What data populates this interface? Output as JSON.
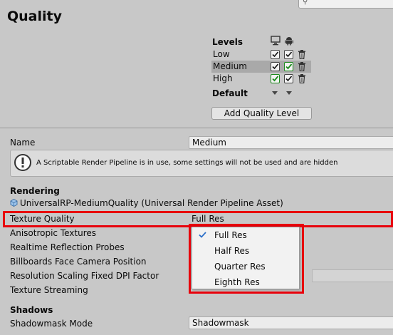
{
  "window": {
    "title": "Quality",
    "search_icon": "search-icon"
  },
  "levels": {
    "header": "Levels",
    "platforms": [
      "monitor-icon",
      "android-icon"
    ],
    "rows": [
      {
        "name": "Low",
        "selected": false,
        "pc": "checked",
        "android": "checked"
      },
      {
        "name": "Medium",
        "selected": true,
        "pc": "checked",
        "android": "checked-green"
      },
      {
        "name": "High",
        "selected": false,
        "pc": "checked-green",
        "android": "checked"
      }
    ],
    "default_label": "Default",
    "add_button": "Add Quality Level"
  },
  "settings": {
    "name_label": "Name",
    "name_value": "Medium",
    "help_text": "A Scriptable Render Pipeline is in use, some settings will not be used and are hidden",
    "rendering_header": "Rendering",
    "pipeline_asset": "UniversalRP-MediumQuality (Universal Render Pipeline Asset)",
    "texture_quality_label": "Texture Quality",
    "texture_quality_value": "Full Res",
    "anisotropic_label": "Anisotropic Textures",
    "realtime_reflection_label": "Realtime Reflection Probes",
    "billboards_label": "Billboards Face Camera Position",
    "resolution_scaling_label": "Resolution Scaling Fixed DPI Factor",
    "texture_streaming_label": "Texture Streaming",
    "shadows_header": "Shadows",
    "shadowmask_label": "Shadowmask Mode",
    "shadowmask_value": "Shadowmask"
  },
  "dropdown": {
    "options": [
      "Full Res",
      "Half Res",
      "Quarter Res",
      "Eighth Res"
    ],
    "selected": "Full Res"
  },
  "colors": {
    "highlight": "#e8000b",
    "selected_row": "#a9a9a9",
    "check_green": "#1a8a1a"
  }
}
